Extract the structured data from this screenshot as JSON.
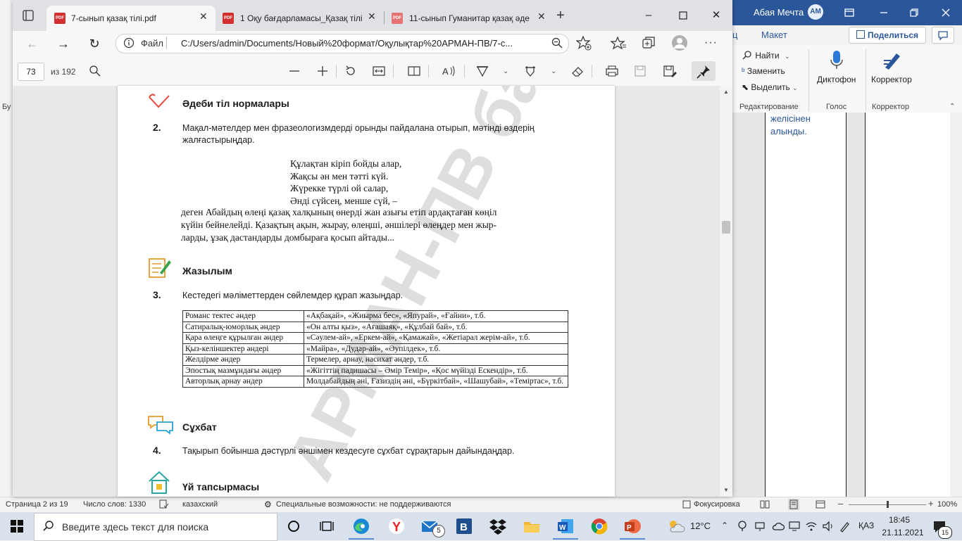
{
  "word": {
    "user_name": "Абая Мечта",
    "user_initials": "АМ",
    "tab_partial": "ц",
    "tab_maket": "Макет",
    "share_label": "Поделиться",
    "ribbon": {
      "find": "Найти",
      "replace": "Заменить",
      "select": "Выделить",
      "dictaphone": "Диктофон",
      "corrector": "Корректор",
      "group_editing": "Редактирование",
      "group_voice": "Голос",
      "group_corrector": "Корректор"
    },
    "left_label": "Бу",
    "doc_text_line1": "желісінен",
    "doc_text_line2": "алынды.",
    "status": {
      "page": "Страница 2 из 19",
      "words": "Число слов: 1330",
      "language": "казахский",
      "accessibility": "Специальные возможности: не поддерживаются",
      "focus": "Фокусировка",
      "zoom": "100%"
    }
  },
  "browser": {
    "tabs": [
      {
        "label": "7-сынып қазақ тілі.pdf",
        "active": true
      },
      {
        "label": "1 Оқу бағдарламасы_Қазақ тілі",
        "active": false
      },
      {
        "label": "11-сынып Гуманитар қазақ әде",
        "active": false
      }
    ],
    "address": {
      "scheme_label": "Файл",
      "url": "C:/Users/admin/Documents/Новый%20формат/Оқулықтар%20АРМАН-ПВ/7-с..."
    },
    "pdf_toolbar": {
      "page_number": "73",
      "page_total": "из 192"
    }
  },
  "pdf_page": {
    "section1_title": "Әдеби тіл нормалары",
    "task2_number": "2.",
    "task2_text_line1": "Мақал-мәтелдер мен фразеологизмдерді орынды пайдалана отырып, мәтінді өздерің",
    "task2_text_line2": "жалғастырыңдар.",
    "poem": [
      "Құлақтан кіріп бойды алар,",
      "Жақсы ән мен тәтті күй.",
      "Жүрекке түрлі ой салар,",
      "Әнді сүйсең, менше сүй, –"
    ],
    "after_poem": [
      "деген Абайдың өлеңі қазақ халқының өнерді жан азығы етіп ардақтаған көңіл",
      "күйін бейнелейді. Қазақтың ақын, жырау, өлеңші, әншілері өлеңдер мен жыр-",
      "ларды, ұзақ дастандарды домбыраға қосып айтады..."
    ],
    "section2_title": "Жазылым",
    "task3_number": "3.",
    "task3_text": "Кестедегі мәліметтерден сөйлемдер құрап жазыңдар.",
    "table": [
      {
        "genre": "Романс тектес әндер",
        "examples": "«Ақбақай», «Жиырма бес», «Япурай», «Ғайни», т.б."
      },
      {
        "genre": "Сатиралық-юморлық әндер",
        "examples": "«Он алты қыз», «Ағашаяқ», «Құлбай бай», т.б."
      },
      {
        "genre": "Қара өлеңге құрылған әндер",
        "examples": "«Сәулем-ай», «Еркем-ай», «Қамажай», «Жетіарал жерім-ай», т.б."
      },
      {
        "genre": "Қыз-келіншектер әндері",
        "examples": "«Майра», «Дудар-ай», «Әупілдек», т.б."
      },
      {
        "genre": "Желдірме әндер",
        "examples": "Термелер, арнау, насихат әндер, т.б."
      },
      {
        "genre": "Эпостық мазмұндағы әндер",
        "examples": "«Жігіттің падишасы – Әмір Темір», «Қос мүйізді Ескендір», т.б."
      },
      {
        "genre": "Авторлық арнау әндер",
        "examples": "Молдабайдың әні, Ғазиздің әні, «Бүркітбай», «Шашубай», «Теміртас», т.б."
      }
    ],
    "section3_title": "Сұхбат",
    "task4_number": "4.",
    "task4_text": "Тақырып бойынша дәстүрлі әншімен кездесуге сұхбат сұрақтарын дайындаңдар.",
    "section4_title": "Үй тапсырмасы",
    "watermark": "АРМАН-ПВ баспасы"
  },
  "taskbar": {
    "search_placeholder": "Введите здесь текст для поиска",
    "mail_badge": "5",
    "temperature": "12°C",
    "language": "ҚАЗ",
    "time": "18:45",
    "date": "21.11.2021",
    "notification_count": "15"
  },
  "colors": {
    "word_blue": "#2b579a",
    "pdf_red": "#d32f2f",
    "taskbar_bg": "#d9e2ec"
  }
}
